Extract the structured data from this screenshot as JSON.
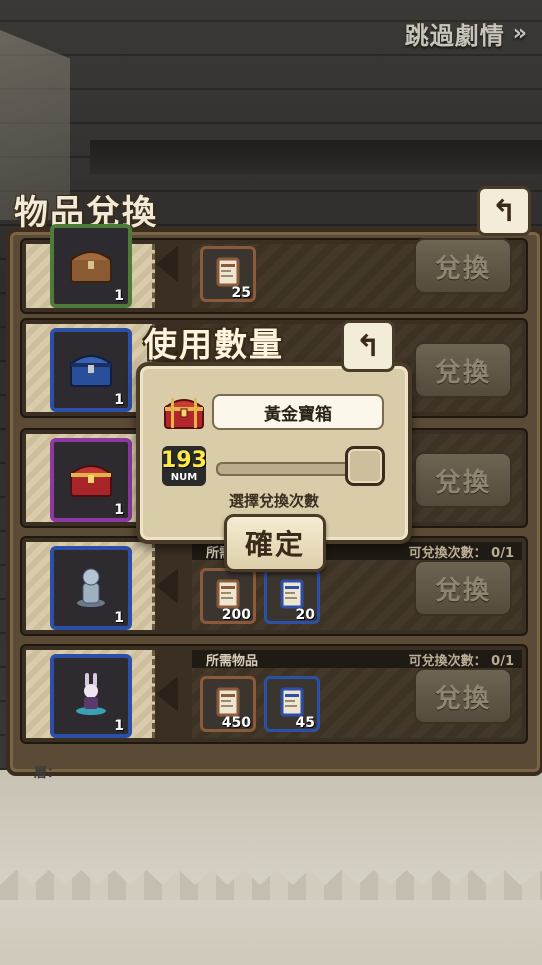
{
  "header": {
    "skip_label": "跳過劇情",
    "skip_arrows": "»"
  },
  "panel": {
    "title": "物品兌換",
    "back_icon": "↰"
  },
  "rows": [
    {
      "item_qty": "1",
      "frame_color": "#4e7a3a",
      "item": "wooden-chest",
      "req_header": "",
      "exchange_count": "",
      "requirements": [
        {
          "num": "25",
          "color": "#8a5a3a"
        }
      ],
      "button": "兌換"
    },
    {
      "item_qty": "1",
      "frame_color": "#2c4fa8",
      "item": "blue-chest",
      "req_header": "",
      "exchange_count": "",
      "requirements": [],
      "button": "兌換"
    },
    {
      "item_qty": "1",
      "frame_color": "#8a3aa0",
      "item": "red-chest",
      "req_header": "",
      "exchange_count": "",
      "requirements": [],
      "button": "兌換"
    },
    {
      "item_qty": "1",
      "frame_color": "#2c4fa8",
      "item": "stone-statue",
      "req_header": "所需物品",
      "exchange_count": "可兌換次數： 0/1",
      "requirements": [
        {
          "num": "200",
          "color": "#8a5a3a"
        },
        {
          "num": "20",
          "color": "#2c4fa8"
        }
      ],
      "button": "兌換"
    },
    {
      "item_qty": "1",
      "frame_color": "#2c4fa8",
      "item": "rabbit-figure",
      "req_header": "所需物品",
      "exchange_count": "可兌換次數： 0/1",
      "requirements": [
        {
          "num": "450",
          "color": "#8a5a3a"
        },
        {
          "num": "45",
          "color": "#2c4fa8"
        }
      ],
      "button": "兌換"
    }
  ],
  "floor_text": "層：",
  "dialog": {
    "title": "使用數量",
    "back_icon": "↰",
    "item_name": "黃金寶箱",
    "count_value": "193",
    "count_unit": "NUM",
    "slider_fraction": 1.0,
    "hint": "選擇兌換次數",
    "confirm": "確定"
  },
  "colors": {
    "panel": "#5b4a35",
    "dialog": "#d9cda9",
    "count_yellow": "#ffe94a"
  }
}
